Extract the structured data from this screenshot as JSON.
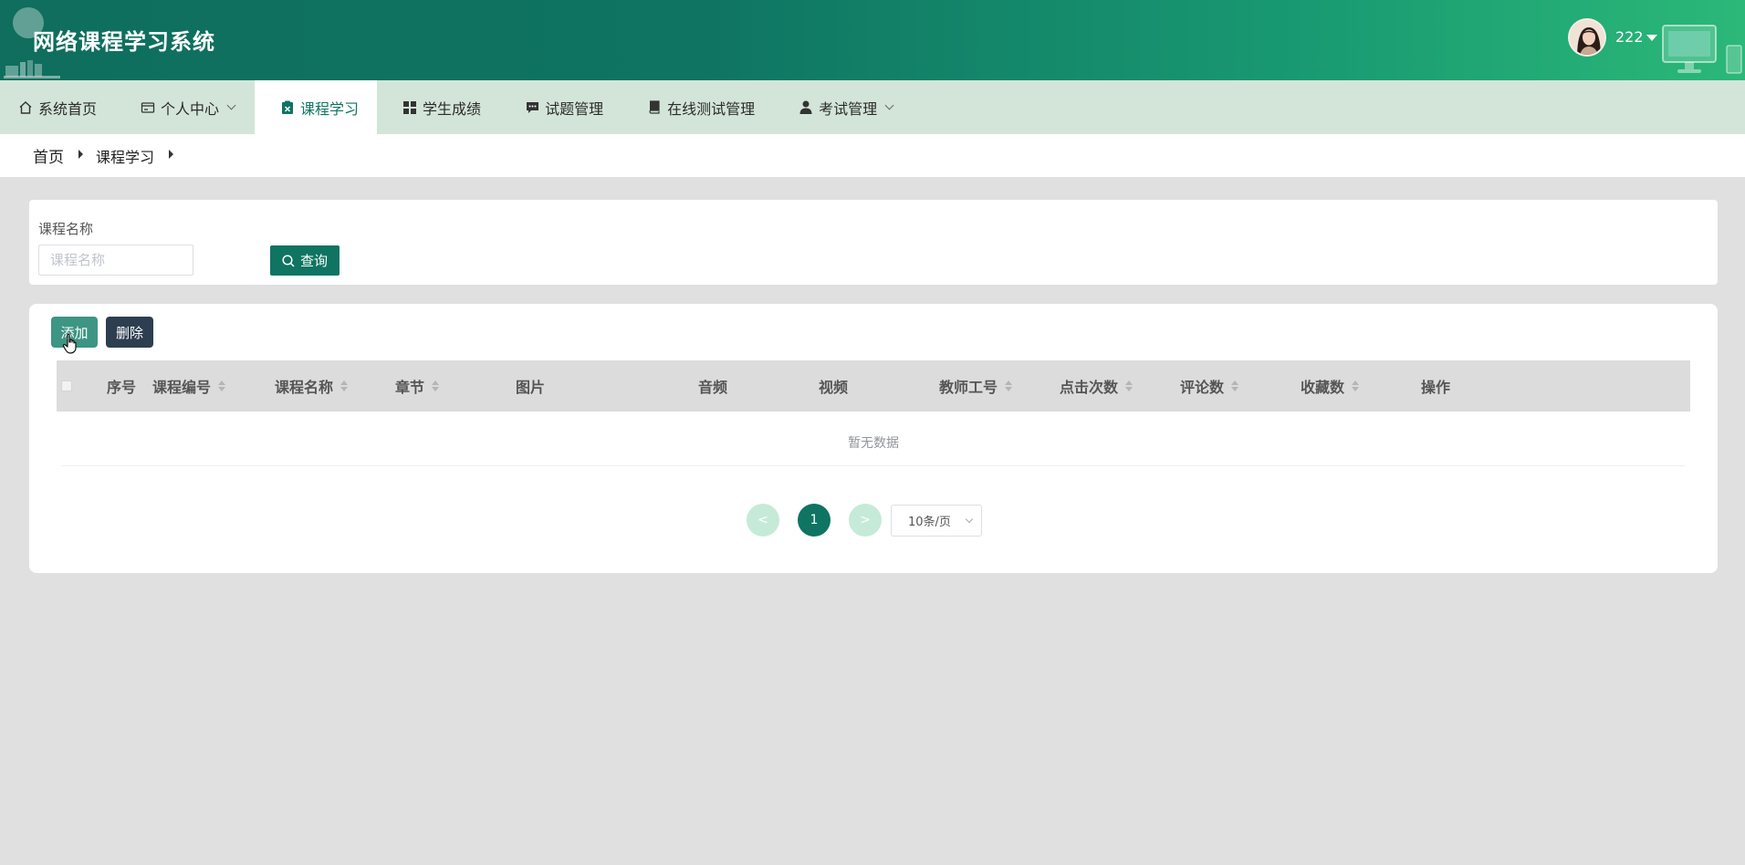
{
  "header": {
    "app_title": "网络课程学习系统",
    "username": "222"
  },
  "nav": {
    "items": [
      {
        "label": "系统首页",
        "icon": "home-icon"
      },
      {
        "label": "个人中心",
        "icon": "id-card-icon",
        "has_dropdown": true
      },
      {
        "label": "课程学习",
        "icon": "clipboard-icon",
        "active": true
      },
      {
        "label": "学生成绩",
        "icon": "grid-icon"
      },
      {
        "label": "试题管理",
        "icon": "chat-icon"
      },
      {
        "label": "在线测试管理",
        "icon": "book-icon"
      },
      {
        "label": "考试管理",
        "icon": "user-icon",
        "has_dropdown": true
      }
    ]
  },
  "breadcrumb": {
    "home": "首页",
    "current": "课程学习"
  },
  "search": {
    "label": "课程名称",
    "placeholder": "课程名称",
    "value": "",
    "button_label": "查询"
  },
  "toolbar": {
    "add_label": "添加",
    "delete_label": "删除"
  },
  "table": {
    "columns": [
      {
        "label": "序号",
        "sortable": false
      },
      {
        "label": "课程编号",
        "sortable": true
      },
      {
        "label": "课程名称",
        "sortable": true
      },
      {
        "label": "章节",
        "sortable": true
      },
      {
        "label": "图片",
        "sortable": false
      },
      {
        "label": "音频",
        "sortable": false
      },
      {
        "label": "视频",
        "sortable": false
      },
      {
        "label": "教师工号",
        "sortable": true
      },
      {
        "label": "点击次数",
        "sortable": true
      },
      {
        "label": "评论数",
        "sortable": true
      },
      {
        "label": "收藏数",
        "sortable": true
      },
      {
        "label": "操作",
        "sortable": false
      }
    ],
    "rows": [],
    "empty_text": "暂无数据"
  },
  "pagination": {
    "prev": "<",
    "current_page": "1",
    "next": ">",
    "page_size": "10条/页"
  },
  "colors": {
    "primary": "#0f7462",
    "nav_bg": "#d3e5d8",
    "add_button": "#3d9583",
    "delete_button": "#2c3e50"
  }
}
